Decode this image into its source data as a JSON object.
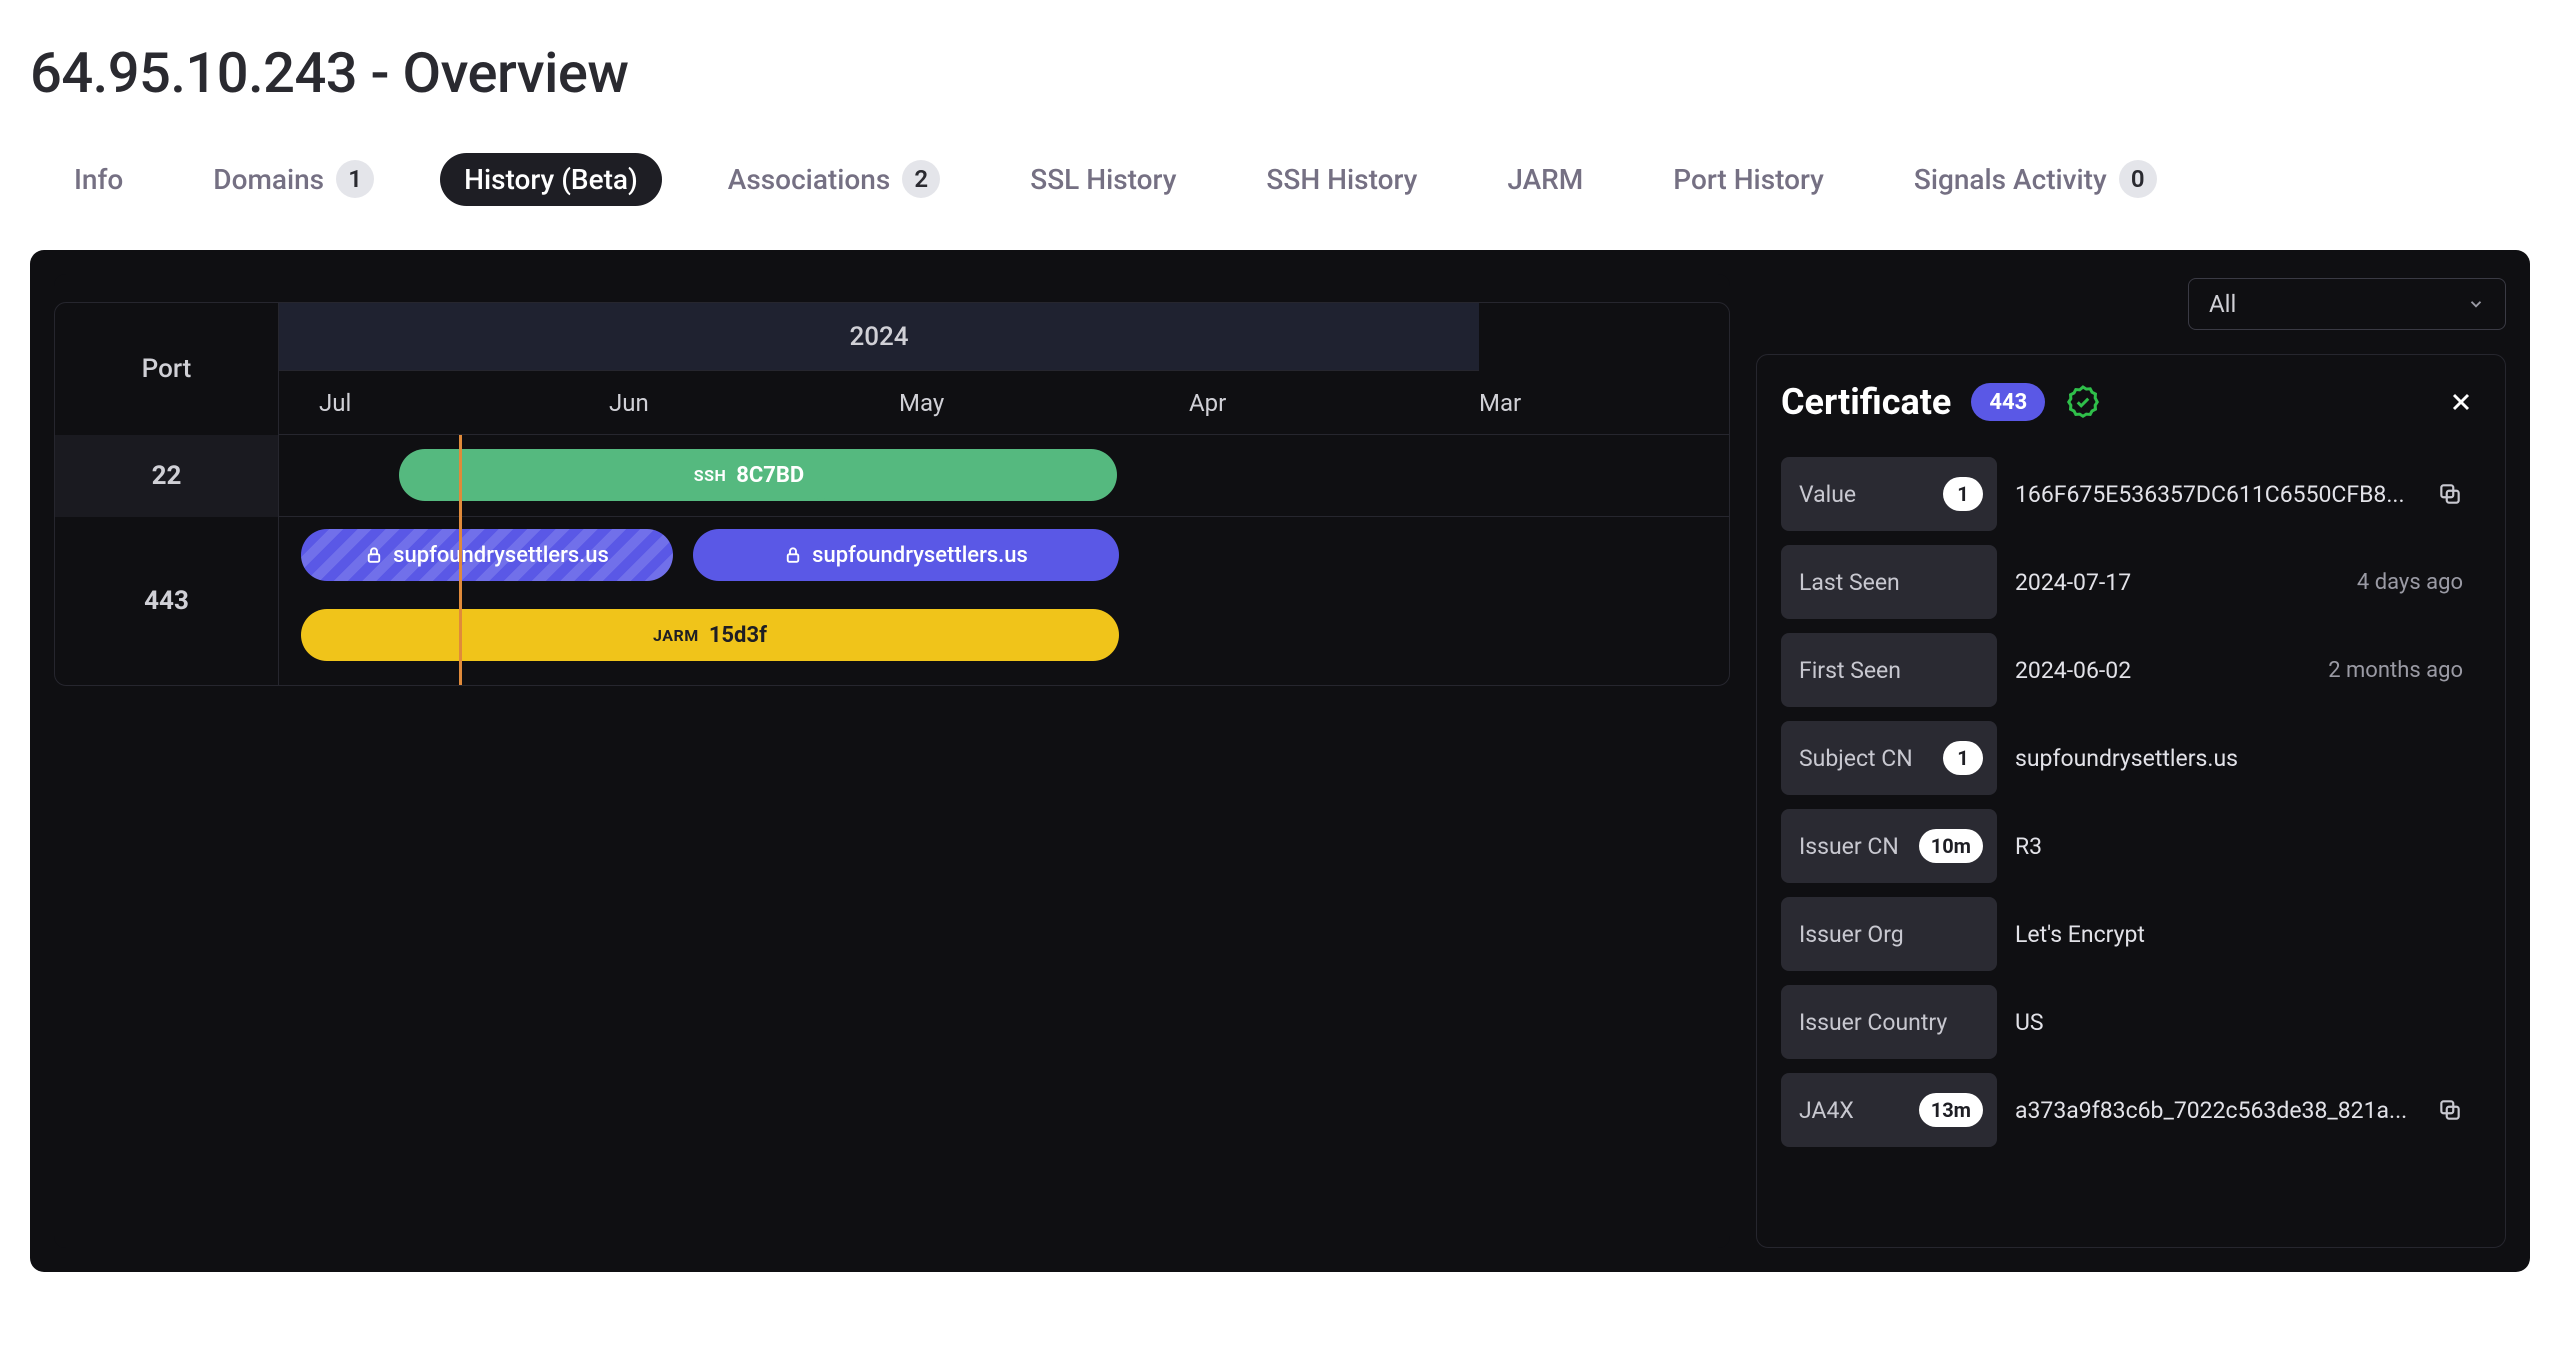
{
  "title": "64.95.10.243 - Overview",
  "tabs": [
    {
      "label": "Info",
      "badge": null,
      "active": false
    },
    {
      "label": "Domains",
      "badge": "1",
      "active": false
    },
    {
      "label": "History (Beta)",
      "badge": null,
      "active": true
    },
    {
      "label": "Associations",
      "badge": "2",
      "active": false
    },
    {
      "label": "SSL History",
      "badge": null,
      "active": false
    },
    {
      "label": "SSH History",
      "badge": null,
      "active": false
    },
    {
      "label": "JARM",
      "badge": null,
      "active": false
    },
    {
      "label": "Port History",
      "badge": null,
      "active": false
    },
    {
      "label": "Signals Activity",
      "badge": "0",
      "active": false
    }
  ],
  "timeline": {
    "port_header": "Port",
    "year": "2024",
    "months": [
      "Jul",
      "Jun",
      "May",
      "Apr",
      "Mar"
    ],
    "rows": {
      "p22": {
        "port": "22",
        "ssh": {
          "prefix": "SSH",
          "value": "8C7BD"
        }
      },
      "p443": {
        "port": "443",
        "ssl1": "supfoundrysettlers.us",
        "ssl2": "supfoundrysettlers.us",
        "jarm": {
          "prefix": "JARM",
          "value": "15d3f"
        }
      }
    }
  },
  "filter": {
    "value": "All"
  },
  "detail": {
    "title": "Certificate",
    "port": "443",
    "fields": {
      "value": {
        "label": "Value",
        "badge": "1",
        "value": "166F675E536357DC611C6550CFB8...",
        "copy": true
      },
      "last_seen": {
        "label": "Last Seen",
        "badge": null,
        "value": "2024-07-17",
        "relative": "4 days ago"
      },
      "first_seen": {
        "label": "First Seen",
        "badge": null,
        "value": "2024-06-02",
        "relative": "2 months ago"
      },
      "subject_cn": {
        "label": "Subject CN",
        "badge": "1",
        "value": "supfoundrysettlers.us"
      },
      "issuer_cn": {
        "label": "Issuer CN",
        "badge": "10m",
        "value": "R3"
      },
      "issuer_org": {
        "label": "Issuer Org",
        "badge": null,
        "value": "Let's Encrypt"
      },
      "issuer_country": {
        "label": "Issuer Country",
        "badge": null,
        "value": "US"
      },
      "ja4x": {
        "label": "JA4X",
        "badge": "13m",
        "value": "a373a9f83c6b_7022c563de38_821a...",
        "copy": true
      }
    }
  }
}
